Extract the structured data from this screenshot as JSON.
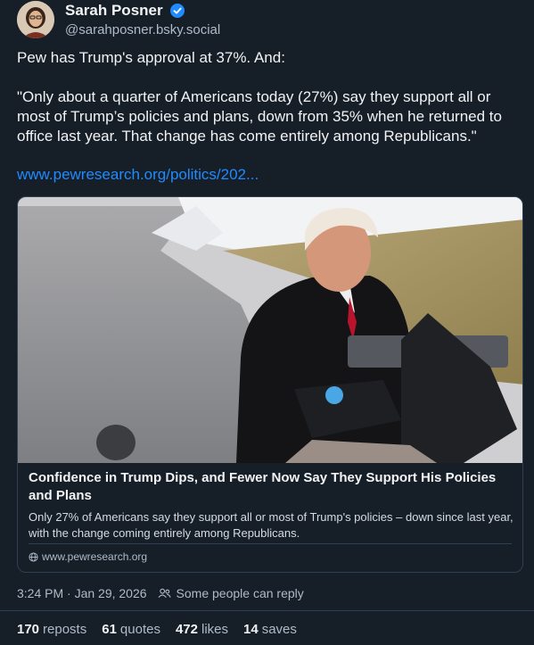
{
  "author": {
    "display_name": "Sarah Posner",
    "handle": "@sarahposner.bsky.social",
    "verified_icon": "verified-check-icon",
    "colors": {
      "verified": "#208bfe"
    }
  },
  "post": {
    "paragraphs": [
      "Pew has Trump's approval at 37%. And:",
      "\"Only about a quarter of Americans today (27%) say they support all or most of Trump’s policies and plans, down from 35% when he returned to office last year. That change has come entirely among Republicans.\""
    ],
    "link_text": "www.pewresearch.org/politics/202..."
  },
  "card": {
    "title": "Confidence in Trump Dips, and Fewer Now Say They Support His Policies and Plans",
    "description": "Only 27% of Americans say they support all or most of Trump's policies – down since last year, with the change coming entirely among Republicans.",
    "domain": "www.pewresearch.org"
  },
  "meta": {
    "timestamp": "3:24 PM · Jan 29, 2026",
    "reply_setting": "Some people can reply"
  },
  "stats": {
    "reposts_count": "170",
    "reposts_label": "reposts",
    "quotes_count": "61",
    "quotes_label": "quotes",
    "likes_count": "472",
    "likes_label": "likes",
    "saves_count": "14",
    "saves_label": "saves"
  },
  "theme": {
    "background": "#161e27",
    "link": "#208bfe",
    "muted": "#aebbc9",
    "border": "#2e4052"
  }
}
